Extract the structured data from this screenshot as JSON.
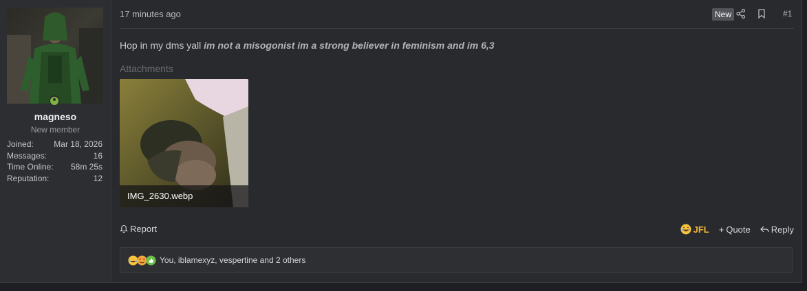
{
  "post": {
    "time": "17 minutes ago",
    "new_badge": "New",
    "number": "#1",
    "body_plain": "Hop in my dms yall ",
    "body_emphasis": "im not a misogonist im a strong believer in feminism and im 6,3",
    "attachments_label": "Attachments",
    "attachment_filename": "IMG_2630.webp"
  },
  "user": {
    "name": "magneso",
    "title": "New member",
    "stats": [
      {
        "label": "Joined:",
        "value": "Mar 18, 2026"
      },
      {
        "label": "Messages:",
        "value": "16"
      },
      {
        "label": "Time Online:",
        "value": "58m 25s"
      },
      {
        "label": "Reputation:",
        "value": "12"
      }
    ]
  },
  "footer": {
    "report": "Report",
    "reaction_given": "JFL",
    "quote": "Quote",
    "reply": "Reply"
  },
  "reactions": {
    "summary": "You, iblamexyz, vespertine and 2 others"
  },
  "colors": {
    "online": "#7cb342",
    "jfl": "#f0b43c"
  }
}
